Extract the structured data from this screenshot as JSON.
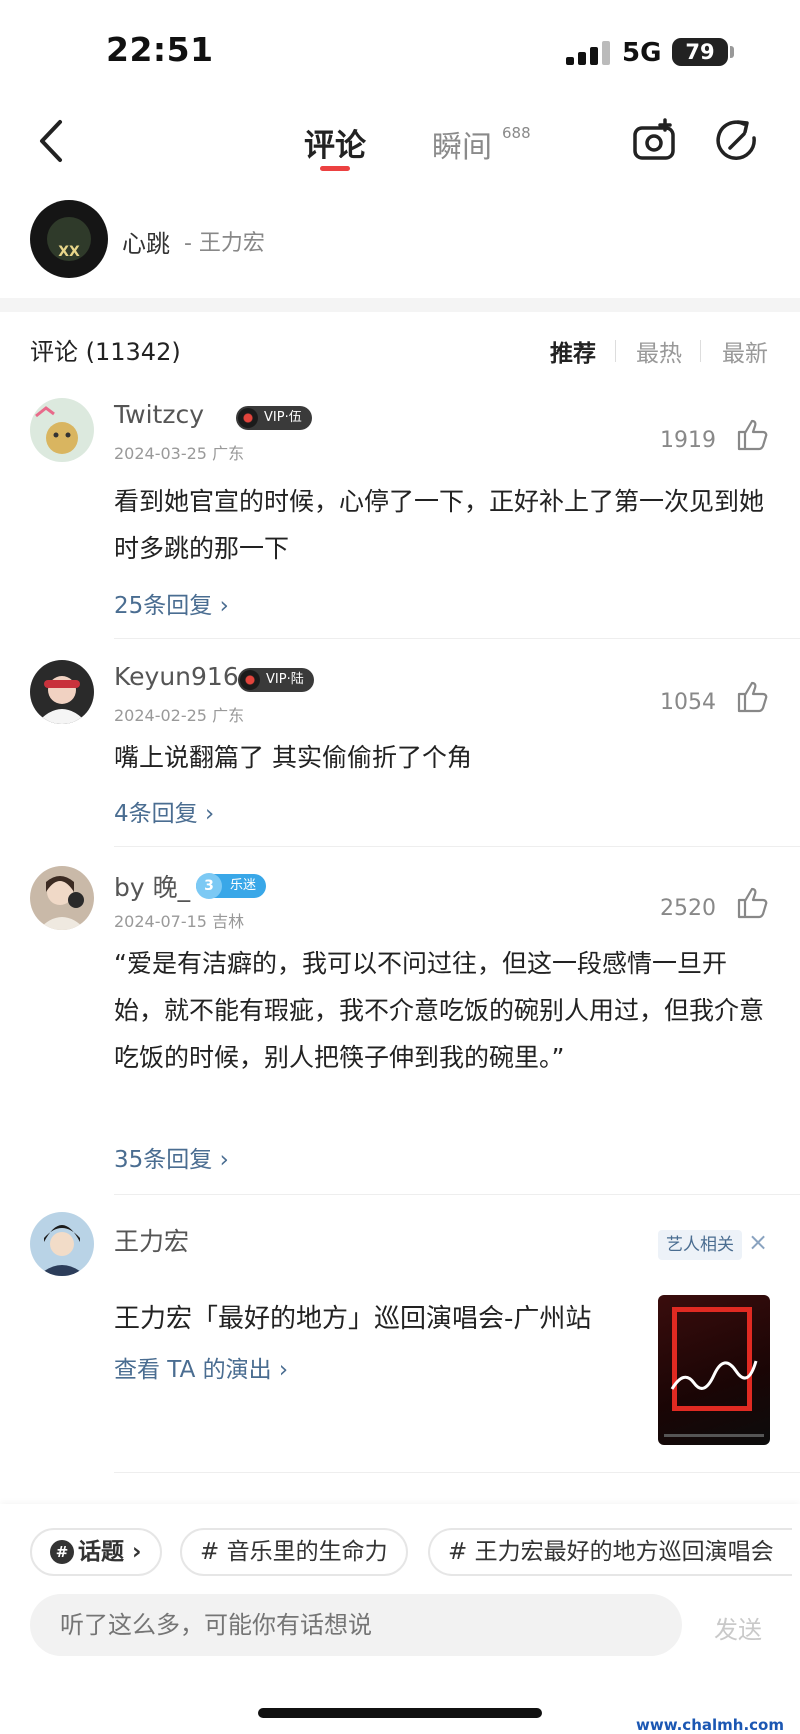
{
  "status": {
    "time": "22:51",
    "network": "5G",
    "battery": "79"
  },
  "nav": {
    "tab_comments": "评论",
    "tab_moments": "瞬间",
    "moments_count": "688"
  },
  "song": {
    "title": "心跳",
    "artist": "- 王力宏",
    "cover_text": "XX"
  },
  "header": {
    "title": "评论 (11342)",
    "sort": [
      "推荐",
      "最热",
      "最新"
    ]
  },
  "comments": [
    {
      "user": "Twitzcy",
      "badge": "VIP·伍",
      "date": "2024-03-25 广东",
      "likes": "1919",
      "text": "看到她官宣的时候，心停了一下，正好补上了第一次见到她时多跳的那一下",
      "replies": "25条回复 ›"
    },
    {
      "user": "Keyun916",
      "badge": "VIP·陆",
      "date": "2024-02-25 广东",
      "likes": "1054",
      "text": "嘴上说翻篇了 其实偷偷折了个角",
      "replies": "4条回复 ›"
    },
    {
      "user": "by 晚_",
      "badge": "乐迷",
      "level": "3",
      "date": "2024-07-15 吉林",
      "likes": "2520",
      "text": "“爱是有洁癖的，我可以不问过往，但这一段感情一旦开始，就不能有瑕疵，我不介意吃饭的碗别人用过，但我介意吃饭的时候，别人把筷子伸到我的碗里。”",
      "replies": "35条回复 ›"
    }
  ],
  "promo": {
    "artist": "王力宏",
    "tag": "艺人相关",
    "close": "×",
    "title": "王力宏「最好的地方」巡回演唱会-广州站",
    "link": "查看 TA 的演出 ›"
  },
  "bottom": {
    "topic_chip": "话题 ›",
    "topic_badge": "#",
    "chips": [
      "# 音乐里的生命力",
      "# 王力宏最好的地方巡回演唱会"
    ],
    "input_placeholder": "听了这么多，可能你有话想说",
    "send": "发送",
    "watermark": "www.chalmh.com"
  },
  "colors": {
    "accent": "#ec4141",
    "link": "#4a6d91",
    "watermark": "#1b57b3"
  }
}
